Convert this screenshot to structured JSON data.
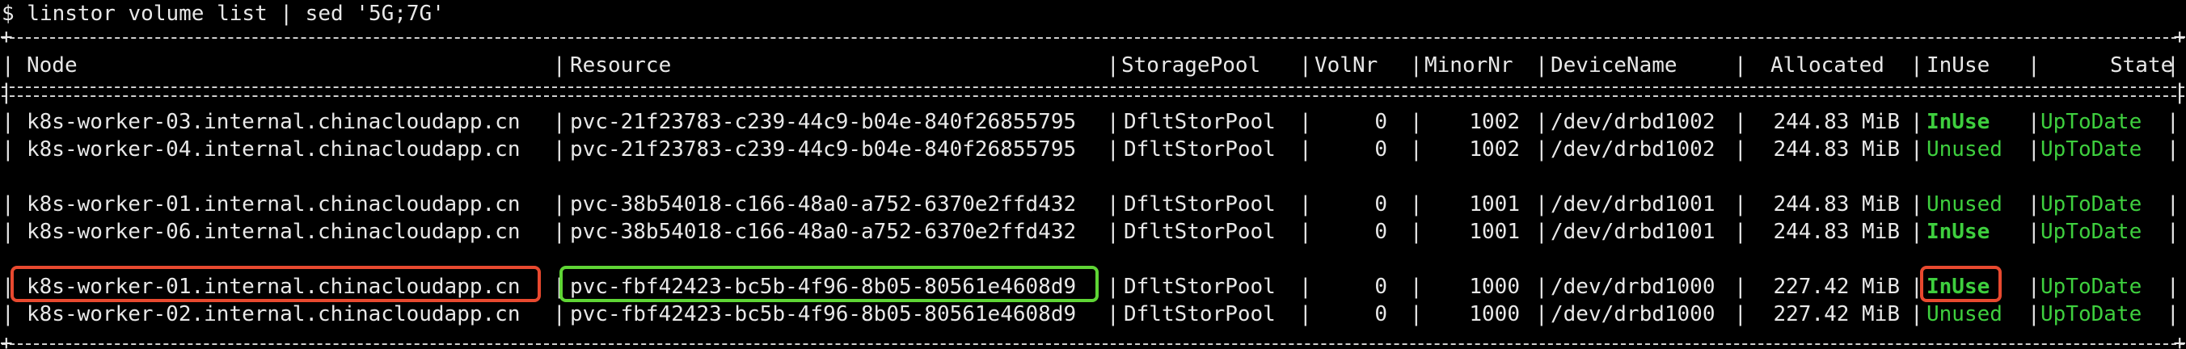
{
  "prompt": "$ linstor volume list | sed '5G;7G'",
  "columns": [
    "Node",
    "Resource",
    "StoragePool",
    "VolNr",
    "MinorNr",
    "DeviceName",
    "Allocated",
    "InUse",
    "State"
  ],
  "rows": [
    {
      "node": "k8s-worker-03.internal.chinacloudapp.cn",
      "resource": "pvc-21f23783-c239-44c9-b04e-840f26855795",
      "pool": "DfltStorPool",
      "volnr": "0",
      "minor": "1002",
      "device": "/dev/drbd1002",
      "allocated": "244.83 MiB",
      "inuse": "InUse",
      "state": "UpToDate"
    },
    {
      "node": "k8s-worker-04.internal.chinacloudapp.cn",
      "resource": "pvc-21f23783-c239-44c9-b04e-840f26855795",
      "pool": "DfltStorPool",
      "volnr": "0",
      "minor": "1002",
      "device": "/dev/drbd1002",
      "allocated": "244.83 MiB",
      "inuse": "Unused",
      "state": "UpToDate"
    },
    {
      "node": "k8s-worker-01.internal.chinacloudapp.cn",
      "resource": "pvc-38b54018-c166-48a0-a752-6370e2ffd432",
      "pool": "DfltStorPool",
      "volnr": "0",
      "minor": "1001",
      "device": "/dev/drbd1001",
      "allocated": "244.83 MiB",
      "inuse": "Unused",
      "state": "UpToDate"
    },
    {
      "node": "k8s-worker-06.internal.chinacloudapp.cn",
      "resource": "pvc-38b54018-c166-48a0-a752-6370e2ffd432",
      "pool": "DfltStorPool",
      "volnr": "0",
      "minor": "1001",
      "device": "/dev/drbd1001",
      "allocated": "244.83 MiB",
      "inuse": "InUse",
      "state": "UpToDate"
    },
    {
      "node": "k8s-worker-01.internal.chinacloudapp.cn",
      "resource": "pvc-fbf42423-bc5b-4f96-8b05-80561e4608d9",
      "pool": "DfltStorPool",
      "volnr": "0",
      "minor": "1000",
      "device": "/dev/drbd1000",
      "allocated": "227.42 MiB",
      "inuse": "InUse",
      "state": "UpToDate"
    },
    {
      "node": "k8s-worker-02.internal.chinacloudapp.cn",
      "resource": "pvc-fbf42423-bc5b-4f96-8b05-80561e4608d9",
      "pool": "DfltStorPool",
      "volnr": "0",
      "minor": "1000",
      "device": "/dev/drbd1000",
      "allocated": "227.42 MiB",
      "inuse": "Unused",
      "state": "UpToDate"
    }
  ],
  "colors": {
    "background": "#000000",
    "text": "#e8e8e8",
    "status_green": "#3ecf3e",
    "highlight_red": "#e8492f",
    "highlight_green": "#5fd535"
  }
}
